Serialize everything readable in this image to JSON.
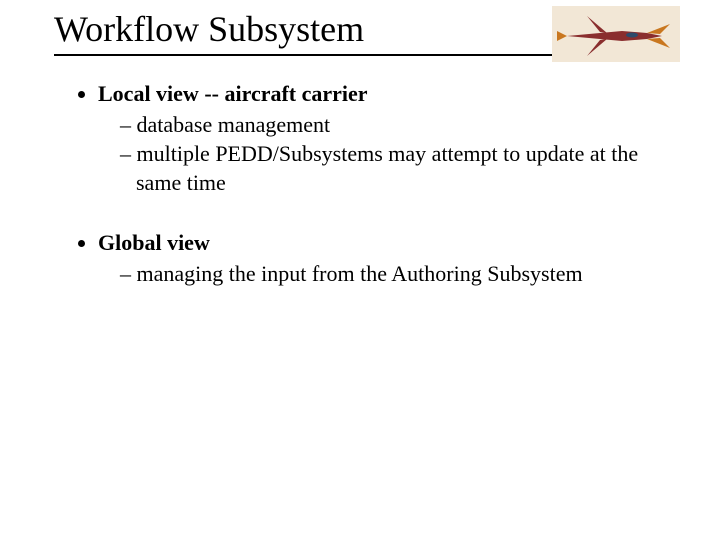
{
  "title": "Workflow Subsystem",
  "icon_label": "fighter-jet",
  "bullets": [
    {
      "head": "Local view -- aircraft carrier",
      "subs": [
        "database management",
        "multiple PEDD/Subsystems may attempt to update at the same time"
      ]
    },
    {
      "head": "Global view",
      "subs": [
        "managing the input from the Authoring Subsystem"
      ]
    }
  ]
}
